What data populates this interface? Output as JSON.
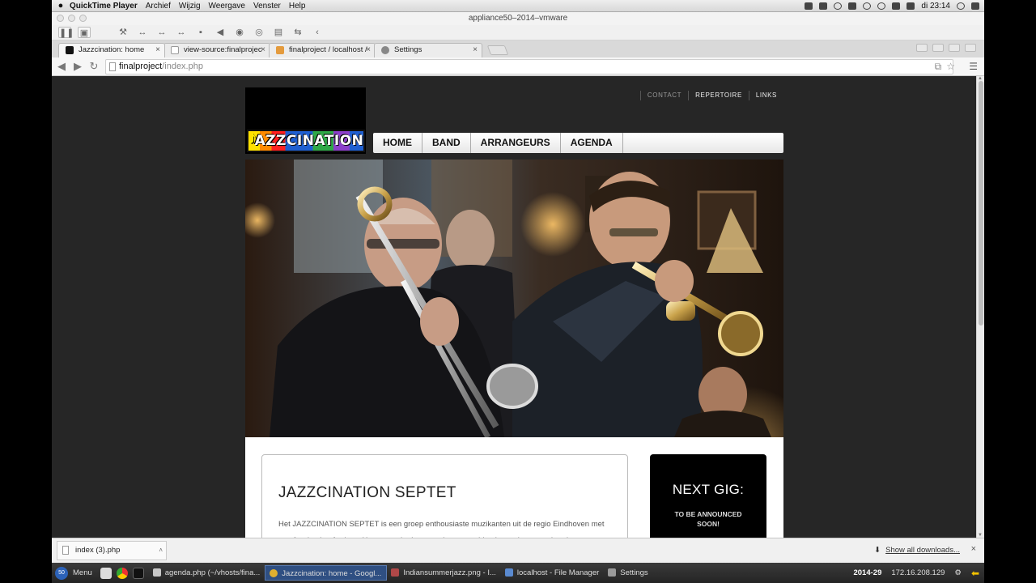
{
  "mac_menubar": {
    "app": "QuickTime Player",
    "menus": [
      "Archief",
      "Wijzig",
      "Weergave",
      "Venster",
      "Help"
    ],
    "clock": "di 23:14"
  },
  "vm_window": {
    "title": "appliance50–2014–vmware"
  },
  "browser": {
    "tabs": [
      {
        "label": "Jazzcination: home",
        "active": true
      },
      {
        "label": "view-source:finalprojec",
        "active": false
      },
      {
        "label": "finalproject / localhost /",
        "active": false
      },
      {
        "label": "Settings",
        "active": false
      }
    ],
    "url_host": "finalproject",
    "url_path": "/index.php"
  },
  "site": {
    "logo_text": "AZZCINATION",
    "logo_note": "♪",
    "top_links": [
      {
        "label": "CONTACT"
      },
      {
        "label": "REPERTOIRE"
      },
      {
        "label": "LINKS"
      }
    ],
    "nav": [
      {
        "label": "HOME"
      },
      {
        "label": "BAND"
      },
      {
        "label": "ARRANGEURS"
      },
      {
        "label": "AGENDA"
      }
    ],
    "article": {
      "title": "JAZZCINATION SEPTET",
      "body": "Het JAZZCINATION SEPTET is een groep enthousiaste muzikanten uit de regio Eindhoven met een fascination-for-jazz. Het repertoire bestaat uit een combinatie van jazz-standaards"
    },
    "gig": {
      "title": "NEXT GIG:",
      "text": "TO BE ANNOUNCED SOON!"
    }
  },
  "downloads": {
    "file": "index (3).php",
    "show_all": "Show all downloads..."
  },
  "taskbar": {
    "start_badge": "50",
    "menu": "Menu",
    "tasks": [
      {
        "label": "agenda.php (~/vhosts/fina...",
        "active": false,
        "color": "#c8c8c8"
      },
      {
        "label": "Jazzcination: home - Googl...",
        "active": true,
        "color": "#e0b030"
      },
      {
        "label": "Indiansummerjazz.png - I...",
        "active": false,
        "color": "#b04848"
      },
      {
        "label": "localhost - File Manager",
        "active": false,
        "color": "#5a8ad0"
      },
      {
        "label": "Settings",
        "active": false,
        "color": "#9a9a9a"
      }
    ],
    "date": "2014-29",
    "ip": "172.16.208.129"
  }
}
